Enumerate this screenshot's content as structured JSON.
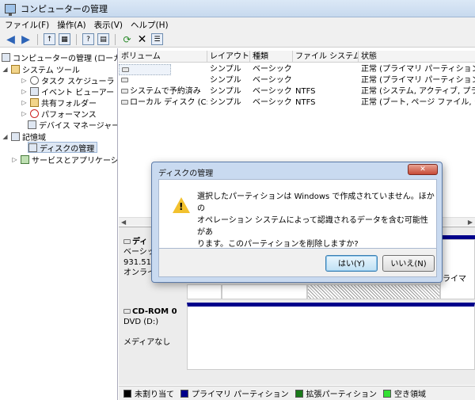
{
  "window": {
    "title": "コンピューターの管理"
  },
  "menu": [
    "ファイル(F)",
    "操作(A)",
    "表示(V)",
    "ヘルプ(H)"
  ],
  "toolbar_icons": [
    "back-arrow-icon",
    "forward-arrow-icon",
    "up-folder-icon",
    "console-tree-icon",
    "help-icon",
    "view-icon",
    "refresh-icon",
    "delete-icon",
    "properties-icon"
  ],
  "tree": {
    "root": "コンピューターの管理 (ローカル)",
    "system_tools": "システム ツール",
    "task_scheduler": "タスク スケジューラ",
    "event_viewer": "イベント ビューアー",
    "shared_folders": "共有フォルダー",
    "performance": "パフォーマンス",
    "device_manager": "デバイス マネージャー",
    "storage": "記憶域",
    "disk_management": "ディスクの管理",
    "services": "サービスとアプリケーション"
  },
  "volume_list": {
    "columns": [
      "ボリューム",
      "レイアウト",
      "種類",
      "ファイル システム",
      "状態"
    ],
    "rows": [
      {
        "volume": "",
        "layout": "シンプル",
        "type": "ベーシック",
        "fs": "",
        "status": "正常 (プライマリ パーティション)"
      },
      {
        "volume": "",
        "layout": "シンプル",
        "type": "ベーシック",
        "fs": "",
        "status": "正常 (プライマリ パーティション)"
      },
      {
        "volume": "システムで予約済み",
        "layout": "シンプル",
        "type": "ベーシック",
        "fs": "NTFS",
        "status": "正常 (システム, アクティブ, プライ"
      },
      {
        "volume": "ローカル ディスク (C:)",
        "layout": "シンプル",
        "type": "ベーシック",
        "fs": "NTFS",
        "status": "正常 (ブート, ページ ファイル, クラッ"
      }
    ]
  },
  "disk_panel": {
    "disk0": {
      "name": "ディ",
      "type": "ベーシッ",
      "size": "931.51 G",
      "state": "オンライ",
      "right_fragment": "ライマ"
    },
    "cdrom": {
      "name": "CD-ROM 0",
      "drive": "DVD (D:)",
      "media": "メディアなし"
    }
  },
  "legend": [
    {
      "label": "未割り当て",
      "color": "#000000"
    },
    {
      "label": "プライマリ パーティション",
      "color": "#00008b"
    },
    {
      "label": "拡張パーティション",
      "color": "#1a7a1a"
    },
    {
      "label": "空き領域",
      "color": "#33e033"
    }
  ],
  "dialog": {
    "title": "ディスクの管理",
    "message_lines": [
      "選択したパーティションは Windows で作成されていません。ほかの",
      "オペレーション システムによって認識されるデータを含む可能性があ",
      "ります。このパーティションを削除しますか?"
    ],
    "yes_label": "はい(Y)",
    "no_label": "いいえ(N)"
  }
}
